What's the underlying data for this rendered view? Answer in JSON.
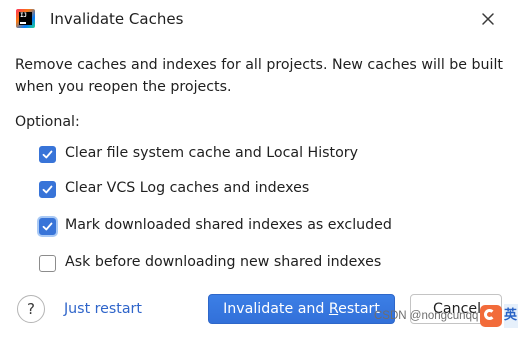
{
  "dialog": {
    "title": "Invalidate Caches",
    "description": "Remove caches and indexes for all projects. New caches will be built when you reopen the projects.",
    "optional_label": "Optional:",
    "icons": {
      "app": "intellij-idea-icon",
      "close": "close-icon"
    }
  },
  "options": [
    {
      "label": "Clear file system cache and Local History",
      "checked": true
    },
    {
      "label": "Clear VCS Log caches and indexes",
      "checked": true
    },
    {
      "label": "Mark downloaded shared indexes as excluded",
      "checked": true,
      "focused": true
    },
    {
      "label": "Ask before downloading new shared indexes",
      "checked": false
    }
  ],
  "footer": {
    "help_label": "?",
    "just_restart_label": "Just restart",
    "primary_label_before": "Invalidate and ",
    "primary_label_mnemonic": "R",
    "primary_label_after": "estart",
    "cancel_label": "Cancel"
  },
  "watermark": {
    "text": "CSDN @nongcunqq",
    "edge_char": "英"
  },
  "colors": {
    "accent": "#3574f0",
    "link": "#2f65ca",
    "checkbox_checked": "#3874d8"
  }
}
